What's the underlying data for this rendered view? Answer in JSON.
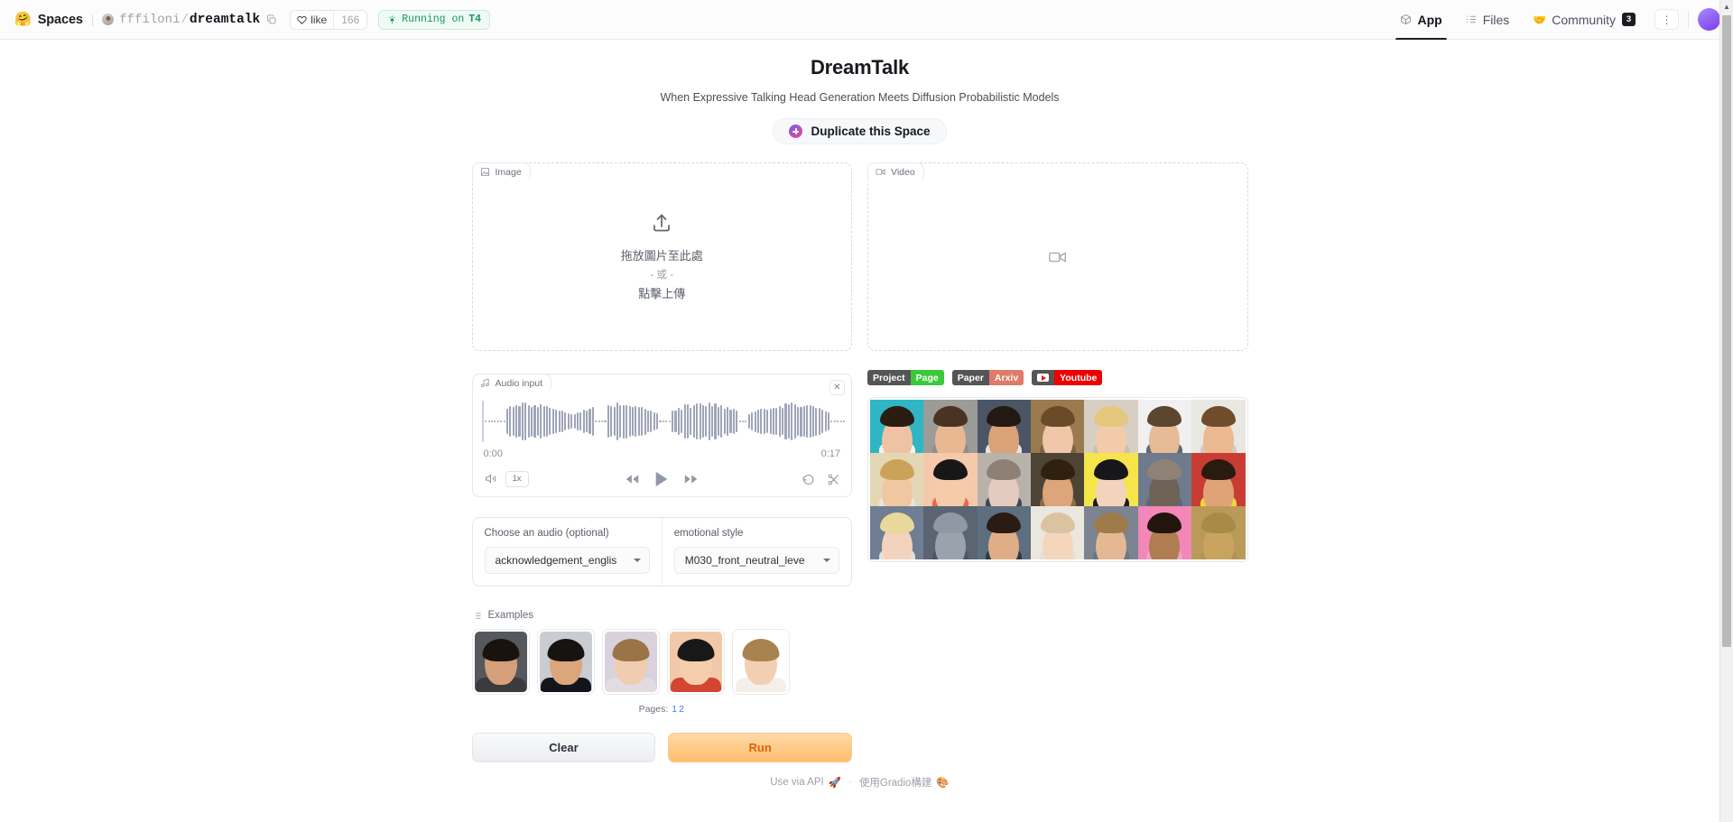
{
  "topbar": {
    "spaces_emoji": "🤗",
    "spaces_label": "Spaces",
    "owner": "fffiloni",
    "slash": "/",
    "repo": "dreamtalk",
    "copy_icon": "copy-icon",
    "like_label": "like",
    "like_count": "166",
    "runtime_badge": "Running on ",
    "runtime_hw": "T4",
    "nav": [
      {
        "label": "App",
        "icon": "cube-icon",
        "active": true
      },
      {
        "label": "Files",
        "icon": "files-icon",
        "active": false
      },
      {
        "label": "Community",
        "icon": "community-icon",
        "badge": "3",
        "active": false
      }
    ],
    "more_icon": "three-dots-icon",
    "avatar": "user-avatar"
  },
  "header": {
    "title": "DreamTalk",
    "subtitle": "When Expressive Talking Head Generation Meets Diffusion Probabilistic Models",
    "duplicate_label": "Duplicate this Space"
  },
  "image_panel": {
    "tab_label": "Image",
    "tab_icon": "image-icon",
    "upload_icon": "upload-icon",
    "drop_text": "拖放圖片至此處",
    "or_text": "- 或 -",
    "click_text": "點擊上傳"
  },
  "video_panel": {
    "tab_label": "Video",
    "tab_icon": "video-icon",
    "placeholder_icon": "video-camera-icon"
  },
  "audio_panel": {
    "tab_label": "Audio input",
    "tab_icon": "music-note-icon",
    "close_icon": "close-icon",
    "time_start": "0:00",
    "time_end": "0:17",
    "volume_icon": "volume-icon",
    "speed_label": "1x",
    "rewind_icon": "rewind-icon",
    "play_icon": "play-icon",
    "forward_icon": "fast-forward-icon",
    "undo_icon": "undo-icon",
    "trim_icon": "scissors-icon"
  },
  "dropdowns": [
    {
      "label": "Choose an audio (optional)",
      "value": "acknowledgement_englis",
      "caret": "chevron-down-icon"
    },
    {
      "label": "emotional style",
      "value": "M030_front_neutral_leve",
      "caret": "chevron-down-icon"
    }
  ],
  "badges": [
    {
      "left": "Project",
      "right": "Page",
      "right_color": "#3ac93a",
      "left_color": "#555555",
      "icon": ""
    },
    {
      "left": "Paper",
      "right": "Arxiv",
      "right_color": "#e07a6a",
      "left_color": "#555555",
      "icon": ""
    },
    {
      "left": "",
      "right": "Youtube",
      "right_color": "#ee0000",
      "left_color": "#555555",
      "icon": "youtube-play-icon"
    }
  ],
  "faces_grid": {
    "rows": 3,
    "cols": 7,
    "cells": [
      {
        "bg": "#2fb6c4",
        "skin": "#f0c2a4",
        "hair": "#2b1c12",
        "cloth": "#f2f2f2"
      },
      {
        "bg": "#9b9b98",
        "skin": "#e8b892",
        "hair": "#4a3322",
        "cloth": "#8d8d8a"
      },
      {
        "bg": "#4b5566",
        "skin": "#d9a277",
        "hair": "#241812",
        "cloth": "#e7e4df"
      },
      {
        "bg": "#9a7a4e",
        "skin": "#efc6a8",
        "hair": "#6b4a28",
        "cloth": "#7d6340"
      },
      {
        "bg": "#d8cfc4",
        "skin": "#f2cbab",
        "hair": "#e4c87d",
        "cloth": "#cbbfae"
      },
      {
        "bg": "#f0f0f0",
        "skin": "#e7bb95",
        "hair": "#5c4630",
        "cloth": "#5e6a78"
      },
      {
        "bg": "#e9e7e2",
        "skin": "#eab98f",
        "hair": "#6e4c2c",
        "cloth": "#cfcac2"
      },
      {
        "bg": "#e4d7b6",
        "skin": "#f1c7a2",
        "hair": "#caa358",
        "cloth": "#e9e5de"
      },
      {
        "bg": "#f5c9ac",
        "skin": "#f6cbaa",
        "hair": "#171717",
        "cloth": "#e4694f"
      },
      {
        "bg": "#b9b2ab",
        "skin": "#e4cbc0",
        "hair": "#8d8176",
        "cloth": "#3c4756"
      },
      {
        "bg": "#4e4436",
        "skin": "#dca57a",
        "hair": "#30210f",
        "cloth": "#8a6b45"
      },
      {
        "bg": "#f5e54a",
        "skin": "#f4d3bc",
        "hair": "#17171b",
        "cloth": "#1b1b20"
      },
      {
        "bg": "#6f7b8c",
        "skin": "#6f6256",
        "hair": "#8e8275",
        "cloth": "#5d6876"
      },
      {
        "bg": "#c83c34",
        "skin": "#e0a377",
        "hair": "#2a1a10",
        "cloth": "#f0d83c"
      },
      {
        "bg": "#6f7e92",
        "skin": "#f3d3bd",
        "hair": "#e8d89a",
        "cloth": "#e4e0d6"
      },
      {
        "bg": "#5b6472",
        "skin": "#9aa2ad",
        "hair": "#8f98a4",
        "cloth": "#4c5562"
      },
      {
        "bg": "#5d6f7f",
        "skin": "#dfae87",
        "hair": "#2b1b12",
        "cloth": "#2e3b46"
      },
      {
        "bg": "#ece7de",
        "skin": "#f4d6bd",
        "hair": "#d9c3a0",
        "cloth": "#e6e0d4"
      },
      {
        "bg": "#7b8490",
        "skin": "#e5b894",
        "hair": "#a07b4a",
        "cloth": "#6c7682"
      },
      {
        "bg": "#f287b8",
        "skin": "#b07c52",
        "hair": "#22150d",
        "cloth": "#f0a3c8"
      },
      {
        "bg": "#b99a58",
        "skin": "#c9a45e",
        "hair": "#a98a47",
        "cloth": "#b39353"
      }
    ]
  },
  "examples": {
    "label": "Examples",
    "icon": "list-icon",
    "items": [
      {
        "bg": "#55585c",
        "skin": "#d5a079",
        "hair": "#1a120c",
        "cloth": "#3a3b3e"
      },
      {
        "bg": "#c9ccd1",
        "skin": "#dca57c",
        "hair": "#171310",
        "cloth": "#14151a"
      },
      {
        "bg": "#d9d2dc",
        "skin": "#f0cdb0",
        "hair": "#9a7447",
        "cloth": "#e3dbe2"
      },
      {
        "bg": "#f2c9a8",
        "skin": "#f6cdab",
        "hair": "#181818",
        "cloth": "#d4452f"
      },
      {
        "bg": "#ffffff",
        "skin": "#f2cfb3",
        "hair": "#a7824f",
        "cloth": "#f4efe9"
      }
    ],
    "pages_label": "Pages:",
    "pages": [
      "1",
      "2"
    ]
  },
  "actions": {
    "clear_label": "Clear",
    "run_label": "Run"
  },
  "footer": {
    "api_label": "Use via API",
    "api_icon": "rocket-icon",
    "separator": "·",
    "built_label": "使用Gradio構建",
    "built_icon": "gradio-icon"
  }
}
